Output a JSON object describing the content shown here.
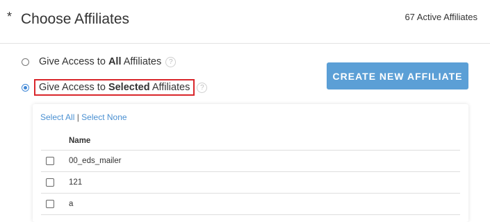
{
  "header": {
    "required_marker": "*",
    "title": "Choose Affiliates",
    "active_count": "67 Active Affiliates"
  },
  "access_options": [
    {
      "prefix": "Give Access to ",
      "bold": "All",
      "suffix": " Affiliates",
      "selected": false
    },
    {
      "prefix": "Give Access to ",
      "bold": "Selected",
      "suffix": " Affiliates",
      "selected": true
    }
  ],
  "help_glyph": "?",
  "create_button": {
    "label": "CREATE NEW AFFILIATE"
  },
  "panel": {
    "select_all": "Select All",
    "separator": "|",
    "select_none": "Select None",
    "column_header": "Name",
    "rows": [
      {
        "name": "00_eds_mailer",
        "checked": false
      },
      {
        "name": "121",
        "checked": false
      },
      {
        "name": "a",
        "checked": false
      }
    ]
  },
  "colors": {
    "accent": "#5b9fd6",
    "link": "#4a90d2",
    "highlight_border": "#d9262b"
  }
}
